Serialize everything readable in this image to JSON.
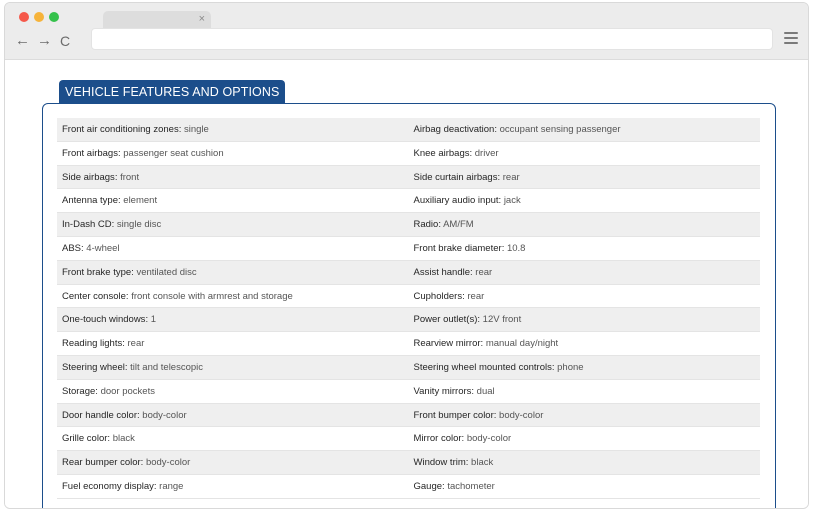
{
  "browser": {
    "tab_close_icon": "×",
    "back_icon": "←",
    "forward_icon": "→",
    "reload_icon": "C",
    "menu_icon": "hamburger-menu"
  },
  "section": {
    "title": "VEHICLE FEATURES AND OPTIONS",
    "accent_color": "#1c4e8b"
  },
  "features": [
    [
      {
        "label": "Front air conditioning zones",
        "value": "single"
      },
      {
        "label": "Airbag deactivation",
        "value": "occupant sensing passenger"
      }
    ],
    [
      {
        "label": "Front airbags",
        "value": "passenger seat cushion"
      },
      {
        "label": "Knee airbags",
        "value": "driver"
      }
    ],
    [
      {
        "label": "Side airbags",
        "value": "front"
      },
      {
        "label": "Side curtain airbags",
        "value": "rear"
      }
    ],
    [
      {
        "label": "Antenna type",
        "value": "element"
      },
      {
        "label": "Auxiliary audio input",
        "value": "jack"
      }
    ],
    [
      {
        "label": "In-Dash CD",
        "value": "single disc"
      },
      {
        "label": "Radio",
        "value": "AM/FM"
      }
    ],
    [
      {
        "label": "ABS",
        "value": "4-wheel"
      },
      {
        "label": "Front brake diameter",
        "value": "10.8"
      }
    ],
    [
      {
        "label": "Front brake type",
        "value": "ventilated disc"
      },
      {
        "label": "Assist handle",
        "value": "rear"
      }
    ],
    [
      {
        "label": "Center console",
        "value": "front console with armrest and storage"
      },
      {
        "label": "Cupholders",
        "value": "rear"
      }
    ],
    [
      {
        "label": "One-touch windows",
        "value": "1"
      },
      {
        "label": "Power outlet(s)",
        "value": "12V front"
      }
    ],
    [
      {
        "label": "Reading lights",
        "value": "rear"
      },
      {
        "label": "Rearview mirror",
        "value": "manual day/night"
      }
    ],
    [
      {
        "label": "Steering wheel",
        "value": "tilt and telescopic"
      },
      {
        "label": "Steering wheel mounted controls",
        "value": "phone"
      }
    ],
    [
      {
        "label": "Storage",
        "value": "door pockets"
      },
      {
        "label": "Vanity mirrors",
        "value": "dual"
      }
    ],
    [
      {
        "label": "Door handle color",
        "value": "body-color"
      },
      {
        "label": "Front bumper color",
        "value": "body-color"
      }
    ],
    [
      {
        "label": "Grille color",
        "value": "black"
      },
      {
        "label": "Mirror color",
        "value": "body-color"
      }
    ],
    [
      {
        "label": "Rear bumper color",
        "value": "body-color"
      },
      {
        "label": "Window trim",
        "value": "black"
      }
    ],
    [
      {
        "label": "Fuel economy display",
        "value": "range"
      },
      {
        "label": "Gauge",
        "value": "tachometer"
      }
    ]
  ]
}
